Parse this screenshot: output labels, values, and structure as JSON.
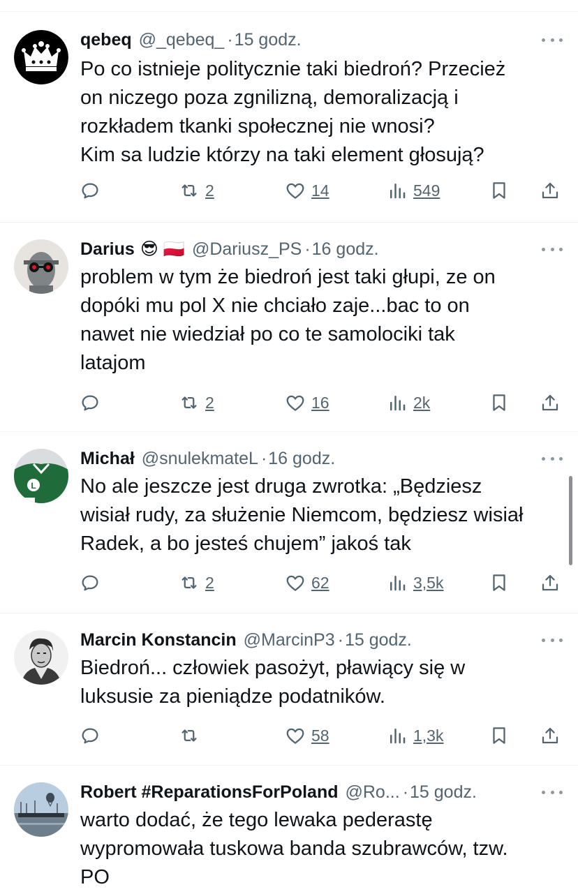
{
  "colors": {
    "text": "#0f1419",
    "muted": "#536471",
    "divider": "#eff3f4",
    "background": "#ffffff"
  },
  "tweets": [
    {
      "name": "qebeq",
      "emoji": "",
      "handle": "@_qebeq_",
      "sep": "·",
      "time": "15 godz.",
      "avatar_icon": "crown-avatar",
      "text": "Po co istnieje politycznie taki biedroń? Przecież\non niczego poza zgnilizną, demoralizacją i\nrozkładem tkanki społecznej nie wnosi?\nKim sa ludzie którzy na taki element głosują?",
      "replies": "",
      "reposts": "2",
      "likes": "14",
      "views": "549"
    },
    {
      "name": "Darius",
      "emoji": "😎 🇵🇱",
      "handle": "@Dariusz_PS",
      "sep": "·",
      "time": "16 godz.",
      "avatar_icon": "statue-sunglasses-avatar",
      "text": "problem w tym że biedroń jest taki głupi, ze on\ndopóki mu pol X nie chciało zaje...bac to on\nnawet nie wiedział po co te samolociki tak\nlatajom",
      "replies": "",
      "reposts": "2",
      "likes": "16",
      "views": "2k"
    },
    {
      "name": "Michał",
      "emoji": "",
      "handle": "@snulekmateL",
      "sep": "·",
      "time": "16 godz.",
      "avatar_icon": "green-jersey-avatar",
      "text": "No ale jeszcze jest druga zwrotka: „Będziesz\nwisiał rudy, za służenie Niemcom, będziesz wisiał\nRadek, a bo jesteś chujem” jakoś tak",
      "replies": "",
      "reposts": "2",
      "likes": "62",
      "views": "3,5k"
    },
    {
      "name": "Marcin Konstancin",
      "emoji": "",
      "handle": "@MarcinP3",
      "sep": "·",
      "time": "15 godz.",
      "avatar_icon": "portrait-avatar",
      "text": "Biedroń... człowiek pasożyt, pławiący się w\nluksusie za pieniądze podatników.",
      "replies": "",
      "reposts": "",
      "likes": "58",
      "views": "1,3k"
    },
    {
      "name": "Robert #ReparationsForPoland",
      "emoji": "",
      "handle": "@Ro...",
      "sep": "·",
      "time": "15 godz.",
      "avatar_icon": "harbor-balloon-avatar",
      "text": "warto dodać, że tego lewaka pederastę\nwypromowała tuskowa banda szubrawców, tzw.\nPO",
      "replies": "",
      "reposts": "",
      "likes": "",
      "views": ""
    }
  ]
}
